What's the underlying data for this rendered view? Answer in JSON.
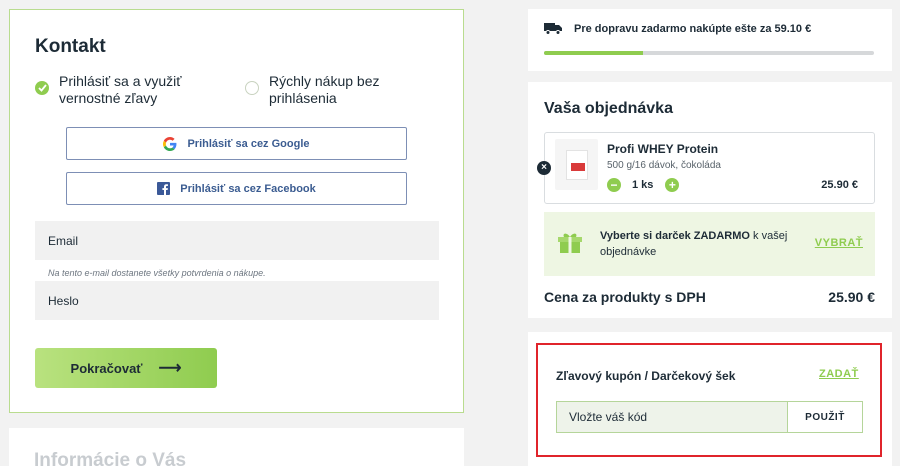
{
  "contact": {
    "title": "Kontakt",
    "option_login": "Prihlásiť sa a využiť vernostné zľavy",
    "option_quick": "Rýchly nákup bez prihlásenia",
    "google_button": "Prihlásiť sa cez Google",
    "facebook_button": "Prihlásiť sa cez Facebook",
    "email_placeholder": "Email",
    "email_hint": "Na tento e-mail dostanete všetky potvrdenia o nákupe.",
    "password_placeholder": "Heslo",
    "continue_button": "Pokračovať",
    "continue_arrow": "⟶"
  },
  "info_section": {
    "title": "Informácie o Vás"
  },
  "shipping": {
    "message": "Pre dopravu zadarmo nakúpte ešte za 59.10 €",
    "progress_fraction": 0.3,
    "icon": "truck-icon"
  },
  "order": {
    "title": "Vaša objednávka",
    "product": {
      "name": "Profi WHEY Protein",
      "description": "500 g/16 dávok, čokoláda",
      "quantity": "1 ks",
      "price": "25.90 €",
      "remove_symbol": "×",
      "minus_symbol": "−",
      "plus_symbol": "+"
    },
    "gift": {
      "text_bold": "Vyberte si darček ZADARMO",
      "text_rest": " k vašej objednávke",
      "link": "VYBRAŤ"
    },
    "total_label": "Cena za produkty s DPH",
    "total_value": "25.90 €"
  },
  "coupon": {
    "label": "Zľavový kupón / Darčekový šek",
    "link": "ZADAŤ",
    "input_placeholder": "Vložte váš kód",
    "apply_button": "POUŽIŤ"
  },
  "colors": {
    "accent_green": "#8fcc4f",
    "highlight_red": "#e0242b",
    "text_dark": "#1d2b36"
  }
}
